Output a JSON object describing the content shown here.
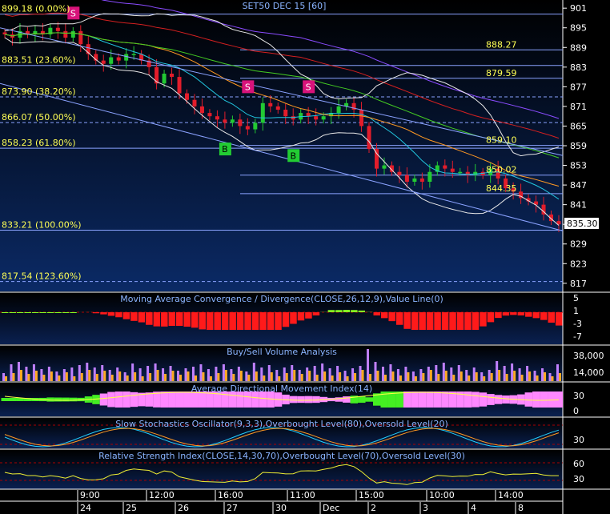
{
  "main": {
    "title": "SET50 DEC 15   [60]",
    "last_price": "835.30",
    "y_ticks": [
      "901",
      "895",
      "889",
      "883",
      "877",
      "871",
      "865",
      "859",
      "853",
      "847",
      "841",
      "835",
      "829",
      "823",
      "817"
    ],
    "fib_levels": [
      {
        "label": "899.18 (0.00%)",
        "value": 899.18
      },
      {
        "label": "883.51 (23.60%)",
        "value": 883.51
      },
      {
        "label": "873.90 (38.20%)",
        "value": 873.9
      },
      {
        "label": "866.07 (50.00%)",
        "value": 866.07
      },
      {
        "label": "858.23 (61.80%)",
        "value": 858.23
      },
      {
        "label": "833.21 (100.00%)",
        "value": 833.21
      },
      {
        "label": "817.54 (123.60%)",
        "value": 817.54
      }
    ],
    "price_tags": [
      {
        "label": "888.27",
        "value": 888.27
      },
      {
        "label": "879.59",
        "value": 879.59
      },
      {
        "label": "859.10",
        "value": 859.1
      },
      {
        "label": "850.02",
        "value": 850.02
      },
      {
        "label": "844.35",
        "value": 844.35
      }
    ],
    "signals": [
      "S",
      "S",
      "S",
      "B",
      "B"
    ],
    "colors": {
      "bg_top": "#000000",
      "bg_bottom": "#0b2a66",
      "fib": "#8aa2ff",
      "up": "#22c933",
      "down": "#e21d2b",
      "label": "#ffff55"
    }
  },
  "macd": {
    "title": "Moving Average Convergence / Divergence(CLOSE,26,12,9),Value Line(0)",
    "y_ticks": [
      "5",
      "1",
      "-3",
      "-7"
    ]
  },
  "volume": {
    "title": "Buy/Sell Volume Analysis",
    "y_ticks": [
      "38,000",
      "14,000"
    ]
  },
  "adx": {
    "title": "Average Directional Movement Index(14)",
    "y_ticks": [
      "30",
      "0"
    ]
  },
  "stoch": {
    "title": "Slow Stochastics Oscillator(9,3,3),Overbought Level(80),Oversold Level(20)",
    "y_ticks": [
      "30"
    ]
  },
  "rsi": {
    "title": "Relative Strength Index(CLOSE,14,30,70),Overbought Level(70),Oversold Level(30)",
    "y_ticks": [
      "60",
      "30"
    ]
  },
  "time_axis": {
    "times": [
      "9:00",
      "12:00",
      "16:00",
      "11:00",
      "15:00",
      "10:00",
      "14:00"
    ],
    "dates": [
      "24",
      "25",
      "26",
      "27",
      "30",
      "Dec",
      "2",
      "3",
      "4",
      "8"
    ]
  },
  "chart_data": {
    "type": "candlestick",
    "title": "SET50 DEC 15   [60]",
    "ylim": [
      815,
      903
    ],
    "y_ticks": [
      901,
      895,
      889,
      883,
      877,
      871,
      865,
      859,
      853,
      847,
      841,
      835,
      829,
      823,
      817
    ],
    "close": [
      893,
      892,
      894,
      893,
      894,
      893,
      895,
      894,
      892,
      894,
      890,
      887,
      885,
      884,
      886,
      885,
      887,
      887,
      885,
      883,
      878,
      881,
      880,
      875,
      873,
      871,
      869,
      868,
      867,
      866,
      867,
      865,
      864,
      866,
      872,
      871,
      870,
      868,
      867,
      869,
      868,
      867,
      868,
      869,
      871,
      872,
      870,
      865,
      858,
      852,
      853,
      851,
      850,
      848,
      849,
      848,
      851,
      853,
      852,
      851,
      851,
      850,
      851,
      850,
      852,
      849,
      846,
      845,
      843,
      842,
      841,
      838,
      836,
      835
    ],
    "fibonacci_levels": [
      {
        "pct": "0.00%",
        "value": 899.18
      },
      {
        "pct": "23.60%",
        "value": 883.51
      },
      {
        "pct": "38.20%",
        "value": 873.9
      },
      {
        "pct": "50.00%",
        "value": 866.07
      },
      {
        "pct": "61.80%",
        "value": 858.23
      },
      {
        "pct": "100.00%",
        "value": 833.21
      },
      {
        "pct": "123.60%",
        "value": 817.54
      }
    ],
    "signals": [
      {
        "type": "S",
        "bar": 9,
        "price": 899.5
      },
      {
        "type": "S",
        "bar": 32,
        "price": 877
      },
      {
        "type": "S",
        "bar": 40,
        "price": 877
      },
      {
        "type": "B",
        "bar": 29,
        "price": 858
      },
      {
        "type": "B",
        "bar": 38,
        "price": 856
      }
    ],
    "last": 835.3,
    "panels": [
      {
        "name": "Moving Average Convergence / Divergence(CLOSE,26,12,9),Value Line(0)",
        "ylim": [
          -8,
          6
        ]
      },
      {
        "name": "Buy/Sell Volume Analysis",
        "ylim": [
          0,
          45000
        ]
      },
      {
        "name": "Average Directional Movement Index(14)",
        "ylim": [
          -10,
          40
        ]
      },
      {
        "name": "Slow Stochastics Oscillator(9,3,3),Overbought Level(80),Oversold Level(20)",
        "ylim": [
          0,
          100
        ]
      },
      {
        "name": "Relative Strength Index(CLOSE,14,30,70),Overbought Level(70),Oversold Level(30)",
        "ylim": [
          0,
          100
        ]
      }
    ]
  }
}
